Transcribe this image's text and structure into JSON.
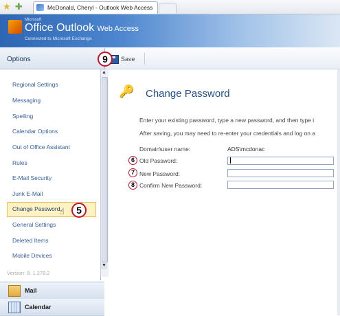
{
  "browser": {
    "tab_title": "McDonald, Cheryl - Outlook Web Access",
    "favorites_icon": "star-icon",
    "add_favorites_icon": "add-favorites-icon"
  },
  "header": {
    "brand_small": "Microsoft",
    "product": "Office Outlook",
    "product_suffix": "Web Access",
    "tagline": "Connected to Microsoft Exchange"
  },
  "options_label": "Options",
  "toolbar": {
    "save_label": "Save"
  },
  "sidebar": {
    "items": [
      {
        "label": "Regional Settings"
      },
      {
        "label": "Messaging"
      },
      {
        "label": "Spelling"
      },
      {
        "label": "Calendar Options"
      },
      {
        "label": "Out of Office Assistant"
      },
      {
        "label": "Rules"
      },
      {
        "label": "E-Mail Security"
      },
      {
        "label": "Junk E-Mail"
      },
      {
        "label": "Change Password"
      },
      {
        "label": "General Settings"
      },
      {
        "label": "Deleted Items"
      },
      {
        "label": "Mobile Devices"
      }
    ],
    "selected": "Change Password",
    "version": "Version: 8. 1.278.2"
  },
  "bottom_nav": {
    "mail": "Mail",
    "calendar": "Calendar"
  },
  "main": {
    "title": "Change Password",
    "instructions_1": "Enter your existing password, type a new password, and then type i",
    "instructions_2": "After saving, you may need to re-enter your credentials and log on a",
    "domain_label": "Domain\\user name:",
    "domain_value": "ADS\\mcdonac",
    "old_password_label": "Old Password:",
    "new_password_label": "New Password:",
    "confirm_password_label": "Confirm New Password:"
  },
  "callouts": {
    "save": "9",
    "change_password": "5",
    "old": "6",
    "new": "7",
    "confirm": "8"
  },
  "colors": {
    "accent": "#2e66b3",
    "callout_border": "#c8102e",
    "link": "#36609d",
    "selected_bg": "#fff3c4"
  }
}
